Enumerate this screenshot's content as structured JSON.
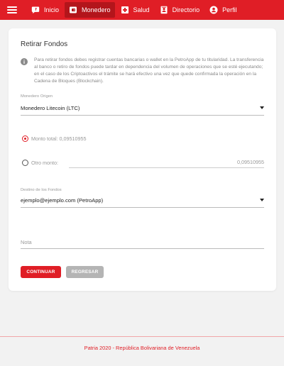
{
  "nav": {
    "items": [
      {
        "label": "Inicio",
        "icon": "chat-bubble-icon",
        "active": false
      },
      {
        "label": "Monedero",
        "icon": "wallet-icon",
        "active": true
      },
      {
        "label": "Salud",
        "icon": "medical-cross-icon",
        "active": false
      },
      {
        "label": "Directorio",
        "icon": "contact-book-icon",
        "active": false
      },
      {
        "label": "Perfil",
        "icon": "user-circle-icon",
        "active": false
      }
    ]
  },
  "form": {
    "title": "Retirar Fondos",
    "info": "Para retirar fondos debes registrar cuentas bancarias o wallet en la PetroApp de tu titularidad. La transferencia al banco o retiro de fondos puede tardar en dependencia del volumen de operaciones que se esté ejecutando; en el caso de los Criptoactivos el trámite se hará efectivo una vez que quede confirmada la operación en la Cadena de Bloques (Blockchain).",
    "origin_label": "Monedero Origen",
    "origin_value": "Monedero Litecoin (LTC)",
    "total_label": "Monto total: 0,09510955",
    "other_label": "Otro monto:",
    "other_value": "0,09510955",
    "dest_label": "Destino de los Fondos",
    "dest_value": "ejemplo@ejemplo.com (PetroApp)",
    "note_placeholder": "Nota",
    "continue_label": "CONTINUAR",
    "back_label": "REGRESAR"
  },
  "footer": {
    "text": "Patria 2020 - República Bolivariana de Venezuela"
  },
  "colors": {
    "brand": "#e01e26",
    "brand_dark": "#b3151b",
    "button_secondary": "#b4b4b4"
  }
}
